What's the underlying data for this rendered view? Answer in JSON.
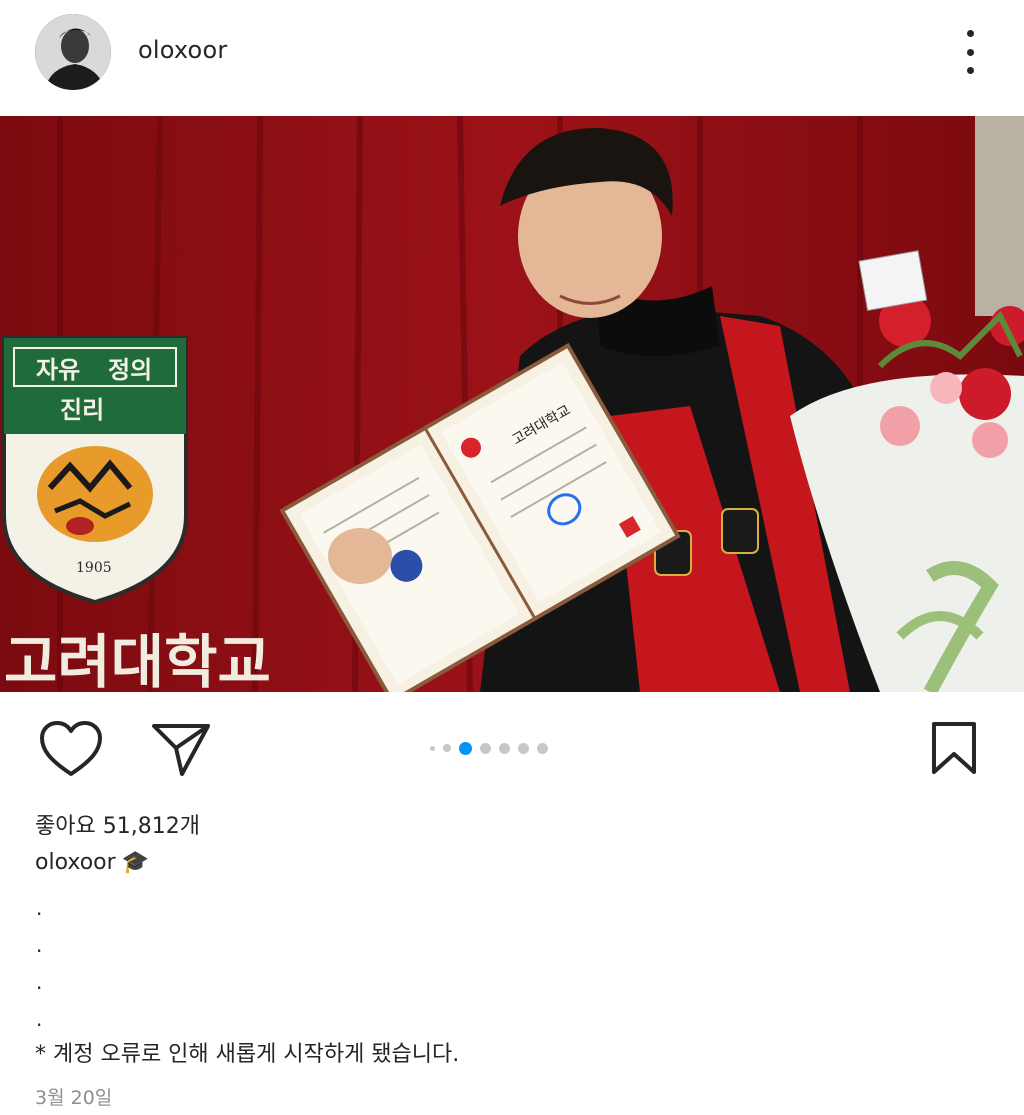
{
  "post": {
    "username": "oloxoor",
    "menu_icon": "more-vertical-icon"
  },
  "photo": {
    "shield_motto_1": "자유",
    "shield_motto_2": "정의",
    "shield_motto_3": "진리",
    "shield_year": "1905",
    "banner_text": "고려대학교",
    "diploma_title": "고려대학교"
  },
  "actions": {
    "like_icon": "heart-icon",
    "share_icon": "send-icon",
    "save_icon": "bookmark-icon",
    "carousel_count": 7,
    "carousel_active_index": 2
  },
  "likes_text": "좋아요 51,812개",
  "caption": {
    "username": "oloxoor",
    "emoji": "🎓",
    "dots": [
      ".",
      ".",
      ".",
      "."
    ],
    "text": "* 계정 오류로 인해 새롭게 시작하게 됐습니다."
  },
  "date": "3월 20일",
  "colors": {
    "curtain": "#8a0f14",
    "gown_red": "#c4161c",
    "accent_blue": "#0095f6",
    "shield_green": "#1f6b3a"
  }
}
